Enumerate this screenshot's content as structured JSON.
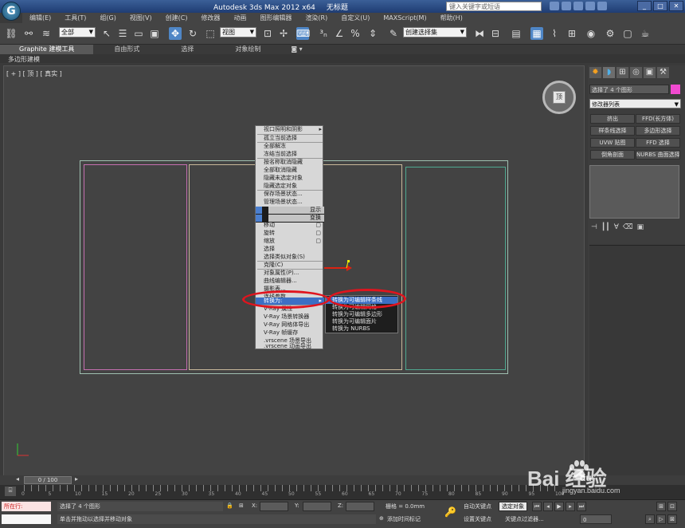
{
  "title": {
    "parts": [
      "Autodesk 3ds Max  2012 x64",
      "无标题"
    ],
    "search_placeholder": "键入关键字或短语"
  },
  "menu": [
    "编辑(E)",
    "工具(T)",
    "组(G)",
    "视图(V)",
    "创建(C)",
    "修改器",
    "动画",
    "图形编辑器",
    "渲染(R)",
    "自定义(U)",
    "MAXScript(M)",
    "帮助(H)"
  ],
  "toolbar": {
    "selection_filter": "全部",
    "ref_coord": "视图",
    "named_selection": "创建选择集"
  },
  "ribbon": {
    "tabs": [
      "Graphite 建模工具",
      "自由形式",
      "选择",
      "对象绘制"
    ],
    "sub_label": "多边形建模"
  },
  "viewport": {
    "label": "[ + ] [ 顶 ] [ 真实 ]",
    "viewcube_face": "顶"
  },
  "quad_menu": {
    "items": [
      "视口照明和阴影",
      "孤立当前选择",
      "全部解冻",
      "冻结当前选择",
      "按名称取消隐藏",
      "全部取消隐藏",
      "隐藏未选定对象",
      "隐藏选定对象",
      "保存场景状态...",
      "管理场景状态..."
    ],
    "display_label": "显示",
    "transform_label": "变换",
    "transform_items": [
      "移动",
      "旋转",
      "缩放",
      "选择",
      "选择类似对象(S)"
    ],
    "transform2_items": [
      "克隆(C)",
      "对象属性(P)...",
      "曲线编辑器...",
      "摄影表...",
      "连线参数..."
    ],
    "convert_label": "转换为:",
    "vray_items": [
      "V-Ray 属性",
      "V-Ray 场景转换器",
      "V-Ray 网格体导出",
      "V-Ray 帧缓存",
      ".vrscene 场景导出",
      ".vrscene 动画导出"
    ]
  },
  "submenu": [
    "转换为可编辑样条线",
    "转换为可编辑网格",
    "转换为可编辑多边形",
    "转换为可编辑面片",
    "转换为 NURBS"
  ],
  "cmdpanel": {
    "selection_info": "选择了 4 个图形",
    "modifier_list": "修改器列表",
    "buttons": [
      [
        "挤出",
        "FFD(长方体)"
      ],
      [
        "样条线选择",
        "多边形选择"
      ],
      [
        "UVW 贴图",
        "FFD 选择"
      ],
      [
        "倒角剖面",
        "NURBS 曲面选择"
      ]
    ]
  },
  "timeslider": {
    "value": "0 / 100"
  },
  "track_numbers": [
    "0",
    "5",
    "10",
    "15",
    "20",
    "25",
    "30",
    "35",
    "40",
    "45",
    "50",
    "55",
    "60",
    "65",
    "70",
    "75",
    "80",
    "85",
    "90",
    "95",
    "100"
  ],
  "status": {
    "script_label": "所在行:",
    "selected": "选择了 4 个图形",
    "hint": "单击并拖动以选择并移动对象",
    "x_label": "X:",
    "y_label": "Y:",
    "z_label": "Z:",
    "grid": "栅格 = 0.0mm",
    "add_time_tag": "添加时间标记",
    "auto_key": "自动关键点",
    "selected_obj": "选定对象",
    "set_key": "设置关键点",
    "key_filters": "关键点过滤器...",
    "frame": "0"
  },
  "watermark": {
    "text": "Bai 经验",
    "du": "du",
    "url": "jingyan.baidu.com"
  }
}
